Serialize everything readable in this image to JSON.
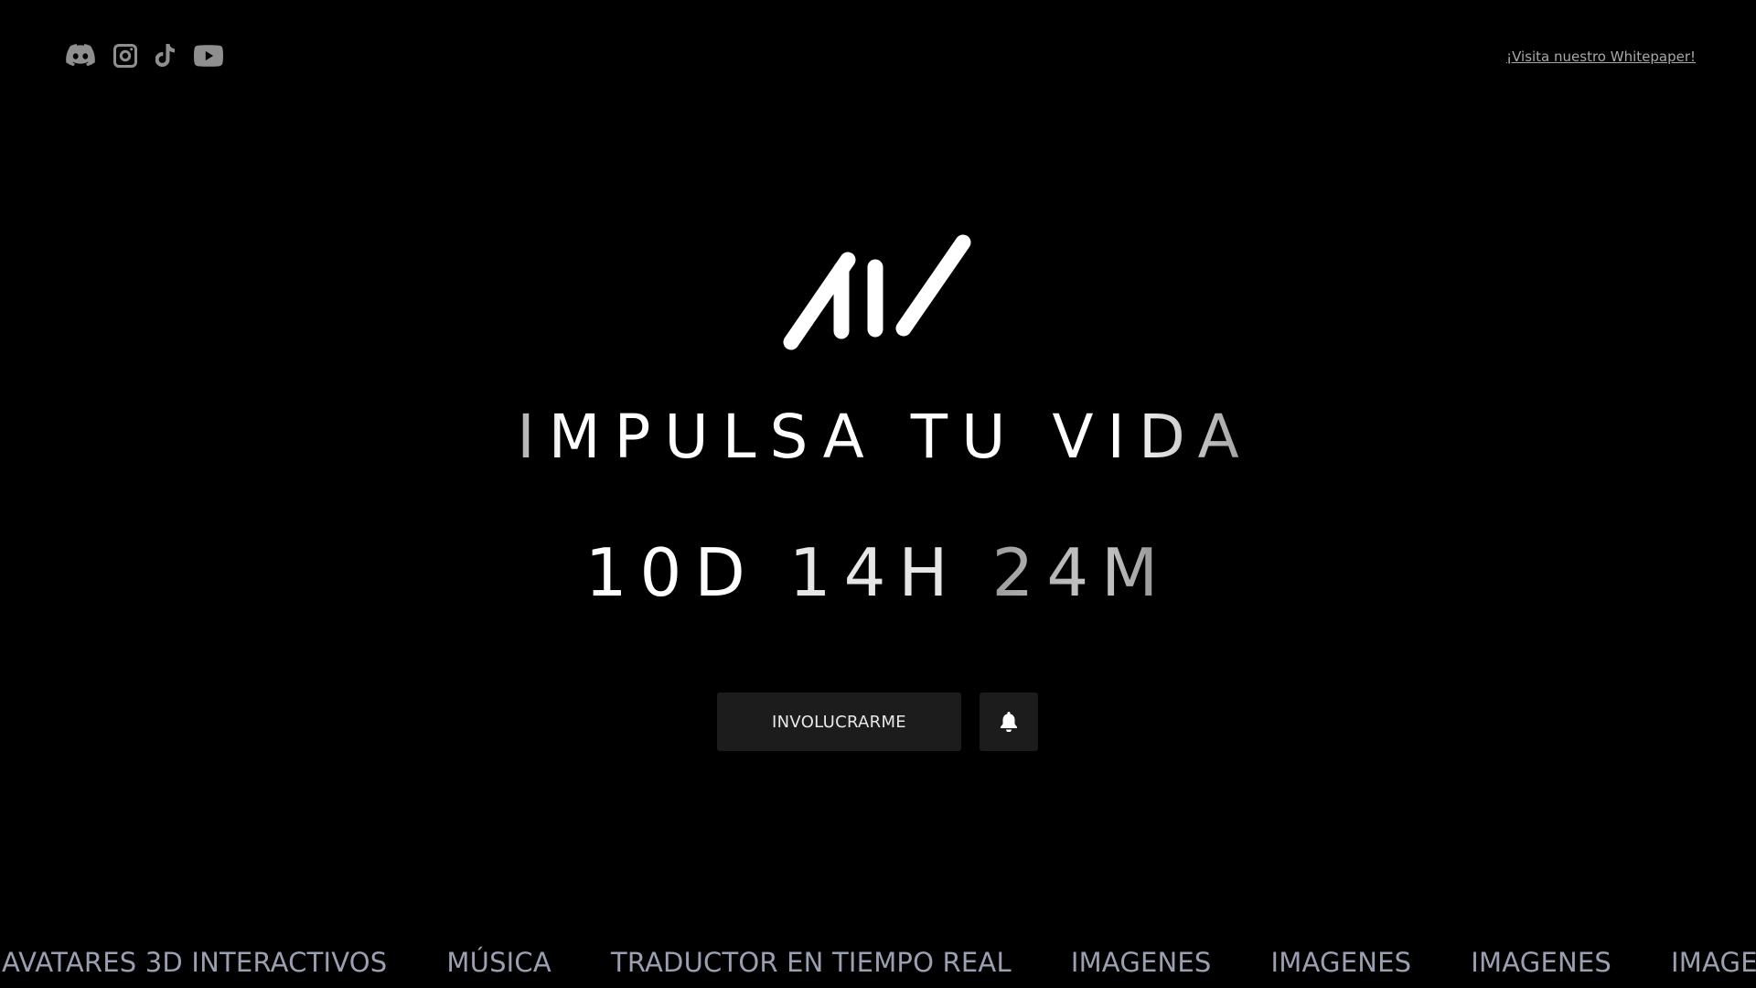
{
  "header": {
    "social_icons": [
      "discord-icon",
      "instagram-icon",
      "tiktok-icon",
      "youtube-icon"
    ],
    "whitepaper_link": "¡Visita nuestro Whitepaper!"
  },
  "hero": {
    "logo_alt": "AIV",
    "slogan": "IMPULSA TU VIDA",
    "countdown": {
      "days": "10D",
      "hours": "14H",
      "minutes": "24M"
    },
    "primary_button": "INVOLUCRARME",
    "bell_icon": "bell-icon"
  },
  "ticker": {
    "items": [
      "AVATARES 3D INTERACTIVOS",
      "MÚSICA",
      "TRADUCTOR EN TIEMPO REAL",
      "IMAGENES",
      "IMAGENES",
      "IMAGENES",
      "IMAGENES"
    ]
  },
  "colors": {
    "background": "#000000",
    "text": "#ffffff",
    "icon_gray": "#8f8f8f",
    "button_bg": "#1c1c1c",
    "ticker_text": "#9aa0b2"
  }
}
